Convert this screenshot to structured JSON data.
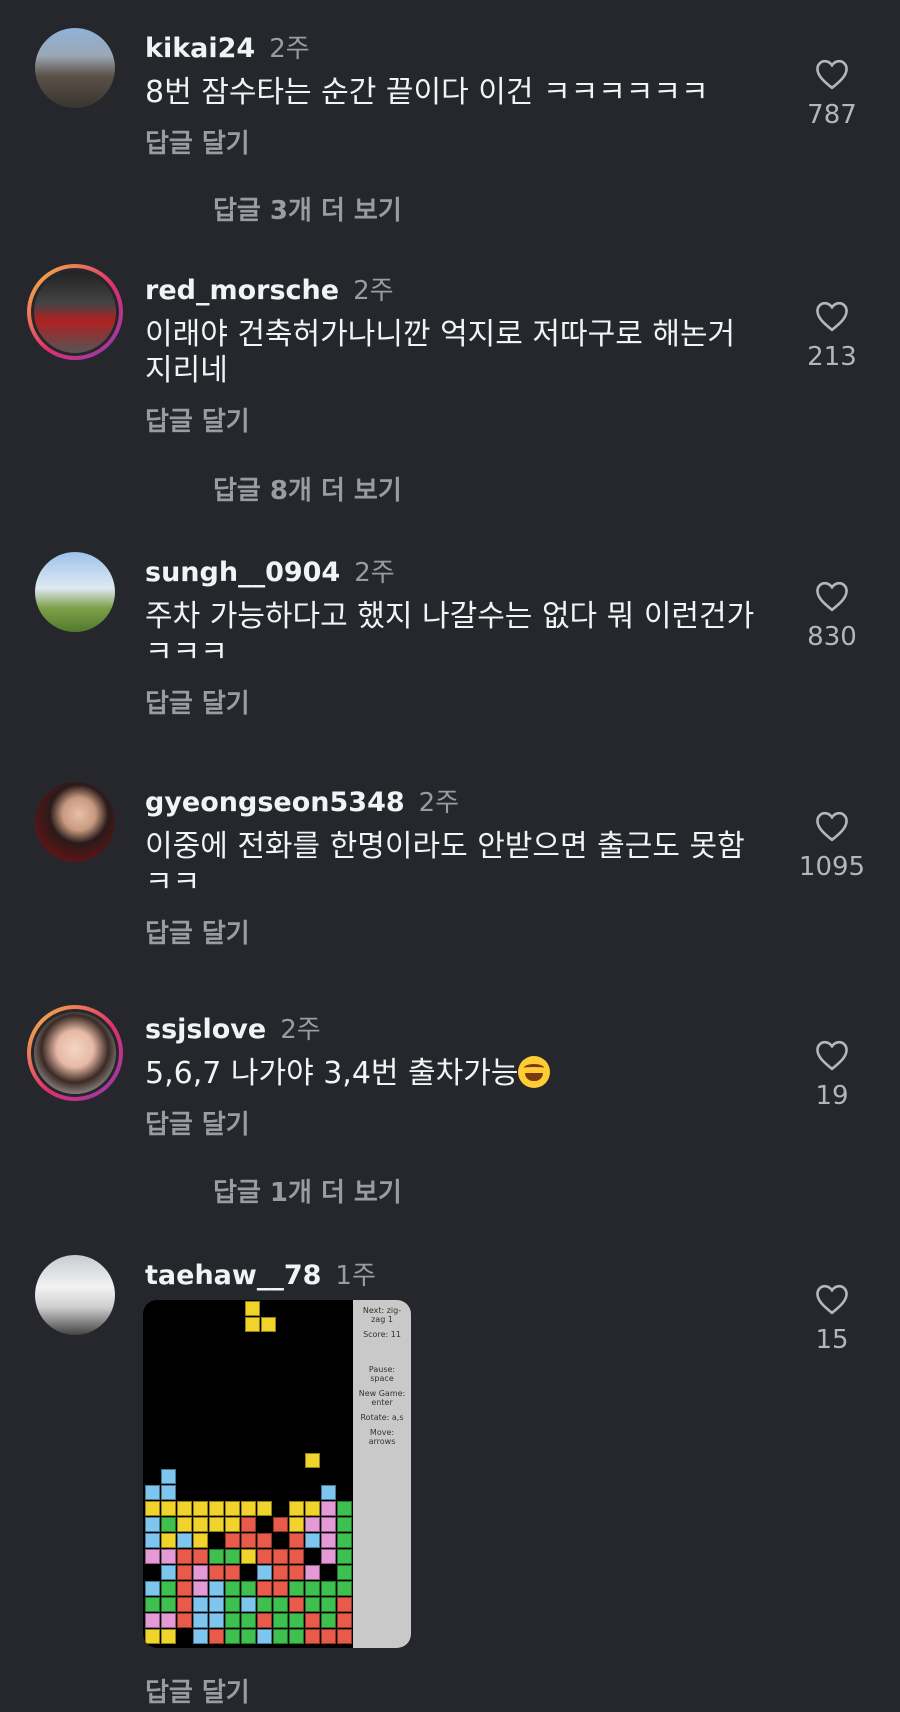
{
  "reply_label": "답글 달기",
  "comments": [
    {
      "username": "kikai24",
      "time": "2주",
      "text": "8번 잠수타는 순간 끝이다 이건 ㅋㅋㅋㅋㅋㅋ",
      "likes": "787",
      "more": "답글 3개 더 보기"
    },
    {
      "username": "red_morsche",
      "time": "2주",
      "text": "이래야 건축허가나니깐 억지로 저따구로 해논거 지리네",
      "likes": "213",
      "more": "답글 8개 더 보기"
    },
    {
      "username": "sungh__0904",
      "time": "2주",
      "text": "주차 가능하다고 했지 나갈수는 없다 뭐 이런건가ㅋㅋㅋ",
      "likes": "830"
    },
    {
      "username": "gyeongseon5348",
      "time": "2주",
      "text": "이중에 전화를 한명이라도 안받으면 출근도 못함 ㅋㅋ",
      "likes": "1095"
    },
    {
      "username": "ssjslove",
      "time": "2주",
      "text": "5,6,7 나가야 3,4번 출차가능",
      "emoji": "tears-of-joy-emoji",
      "likes": "19",
      "more": "답글 1개 더 보기"
    },
    {
      "username": "taehaw__78",
      "time": "1주",
      "likes": "15"
    }
  ],
  "tetris_panel": [
    "Next: zig-zag 1",
    "Score: 11",
    "Pause: space",
    "New Game: enter",
    "Rotate: a,s",
    "Move: arrows"
  ],
  "colors": {
    "background": "#25272c",
    "muted": "#9a9ca2"
  }
}
